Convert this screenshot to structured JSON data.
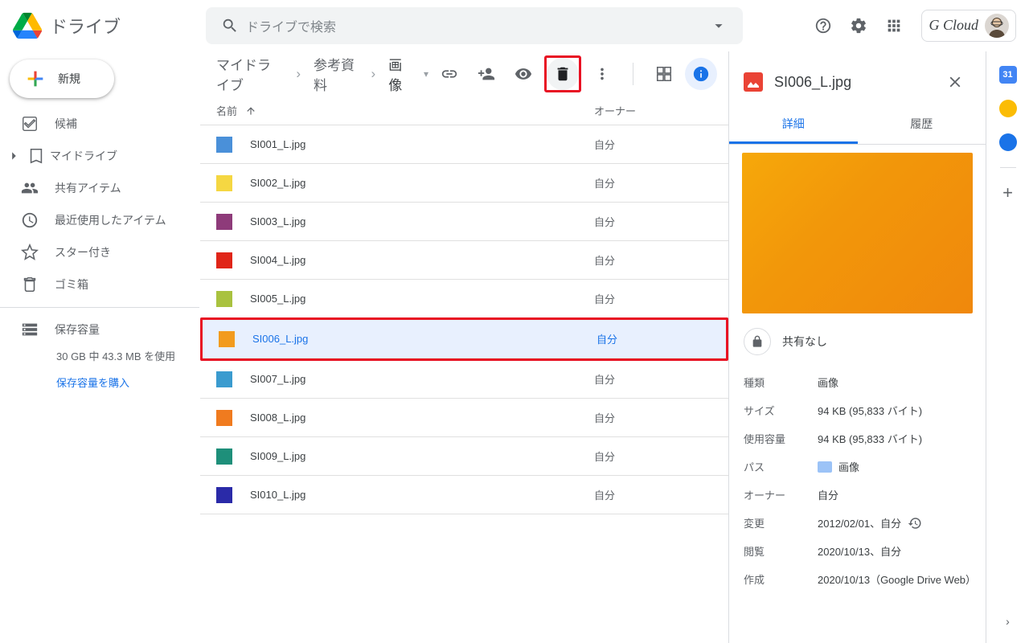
{
  "app_name": "ドライブ",
  "search_placeholder": "ドライブで検索",
  "brand_chip": "G Cloud",
  "new_button": "新規",
  "sidebar": {
    "items": [
      {
        "label": "候補"
      },
      {
        "label": "マイドライブ"
      },
      {
        "label": "共有アイテム"
      },
      {
        "label": "最近使用したアイテム"
      },
      {
        "label": "スター付き"
      },
      {
        "label": "ゴミ箱"
      }
    ],
    "storage_label": "保存容量",
    "storage_usage": "30 GB 中 43.3 MB を使用",
    "buy": "保存容量を購入"
  },
  "breadcrumbs": [
    "マイドライブ",
    "参考資料",
    "画像"
  ],
  "columns": {
    "name": "名前",
    "owner": "オーナー"
  },
  "files": [
    {
      "name": "SI001_L.jpg",
      "owner": "自分",
      "color": "#4a90d9"
    },
    {
      "name": "SI002_L.jpg",
      "owner": "自分",
      "color": "#f5d742"
    },
    {
      "name": "SI003_L.jpg",
      "owner": "自分",
      "color": "#8e3b7a"
    },
    {
      "name": "SI004_L.jpg",
      "owner": "自分",
      "color": "#e02518"
    },
    {
      "name": "SI005_L.jpg",
      "owner": "自分",
      "color": "#a9c23f"
    },
    {
      "name": "SI006_L.jpg",
      "owner": "自分",
      "color": "#f29b1e",
      "selected": true
    },
    {
      "name": "SI007_L.jpg",
      "owner": "自分",
      "color": "#3a9bcf"
    },
    {
      "name": "SI008_L.jpg",
      "owner": "自分",
      "color": "#f07b1f"
    },
    {
      "name": "SI009_L.jpg",
      "owner": "自分",
      "color": "#1e8f7a"
    },
    {
      "name": "SI010_L.jpg",
      "owner": "自分",
      "color": "#2a2aa8"
    }
  ],
  "details": {
    "title": "SI006_L.jpg",
    "tab_details": "詳細",
    "tab_history": "履歴",
    "share_status": "共有なし",
    "meta": {
      "type": {
        "k": "種類",
        "v": "画像"
      },
      "size": {
        "k": "サイズ",
        "v": "94 KB (95,833 バイト)"
      },
      "usage": {
        "k": "使用容量",
        "v": "94 KB (95,833 バイト)"
      },
      "path": {
        "k": "パス",
        "v": "画像"
      },
      "owner": {
        "k": "オーナー",
        "v": "自分"
      },
      "modified": {
        "k": "変更",
        "v": "2012/02/01、自分"
      },
      "viewed": {
        "k": "閲覧",
        "v": "2020/10/13、自分"
      },
      "created": {
        "k": "作成",
        "v": "2020/10/13（Google Drive Web）"
      }
    }
  }
}
